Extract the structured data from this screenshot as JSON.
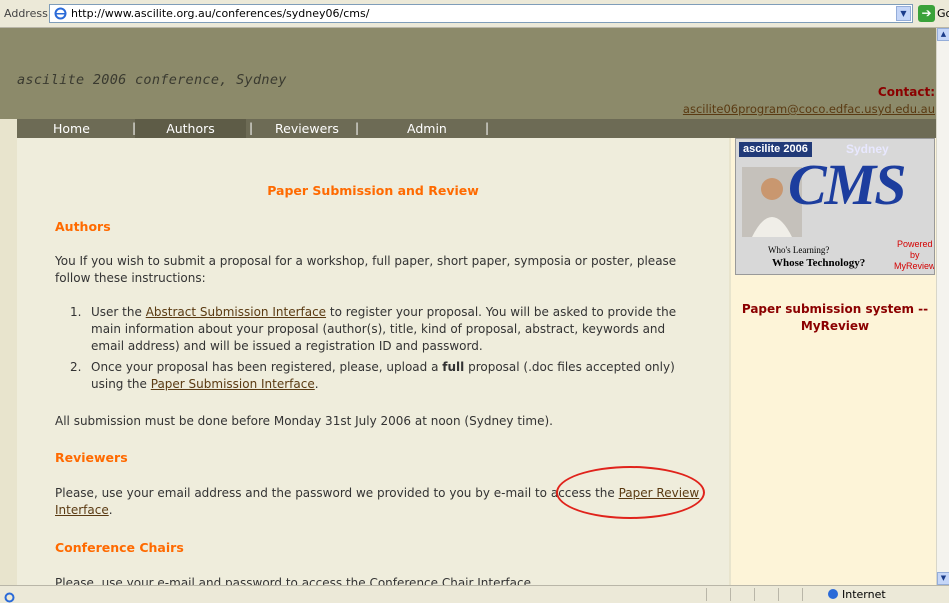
{
  "browser": {
    "address_label": "Address",
    "url": "http://www.ascilite.org.au/conferences/sydney06/cms/",
    "go_label": "Go",
    "status_zone": "Internet"
  },
  "header": {
    "site_title": "ascilite 2006 conference, Sydney",
    "contact_label": "Contact:",
    "contact_email": "ascilite06program@coco.edfac.usyd.edu.au"
  },
  "nav": {
    "items": [
      {
        "label": "Home"
      },
      {
        "label": "Authors"
      },
      {
        "label": "Reviewers"
      },
      {
        "label": "Admin"
      }
    ],
    "separator": "|"
  },
  "main": {
    "title": "Paper Submission and Review",
    "authors_heading": "Authors",
    "authors_intro_1": "You If you wish to submit a proposal for a workshop, full paper, short paper, symposia or poster, please",
    "authors_intro_2": "follow these instructions:",
    "step1_num": "1.",
    "step1_pre": "User the ",
    "step1_link": "Abstract Submission Interface",
    "step1_post": " to register your proposal. You will be asked to provide the",
    "step1_line2": "main information about your proposal (author(s), title, kind of proposal, abstract, keywords and",
    "step1_line3": "email address) and will be issued a registration ID and password.",
    "step2_num": "2.",
    "step2_pre": "Once your proposal has been registered, please, upload a ",
    "step2_bold": "full",
    "step2_post": " proposal (.doc files accepted only)",
    "step2_line2_pre": "using the ",
    "step2_link": "Paper Submission Interface",
    "step2_line2_post": ".",
    "deadline": "All submission must be done before Monday 31st July 2006 at noon (Sydney time).",
    "reviewers_heading": "Reviewers",
    "reviewers_text": "Please, use your email address and the password we provided to you by e-mail to access the ",
    "reviewers_link_1": "Paper Review",
    "reviewers_link_2": "Interface",
    "reviewers_post": ".",
    "chairs_heading": "Conference Chairs",
    "chairs_text": "Please, use your e-mail and password to access the Conference Chair Interface"
  },
  "sidebar": {
    "logo_top": "ascilite 2006",
    "logo_city": "Sydney",
    "logo_cms": "CMS",
    "logo_who": "Who's Learning?",
    "logo_whose": "Whose Technology?",
    "logo_powered_1": "Powered by",
    "logo_powered_2": "MyReview",
    "link_line_1": "Paper submission system --",
    "link_line_2": "MyReview"
  }
}
